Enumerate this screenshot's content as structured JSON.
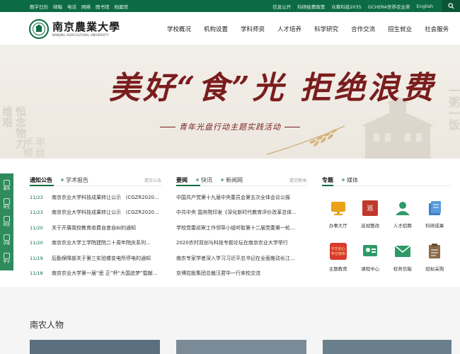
{
  "topbar": {
    "left_links": [
      "教学日历",
      "邮箱",
      "电话",
      "网络",
      "图书馆",
      "档案馆"
    ],
    "right_links": [
      "信息公开",
      "科研经费政策",
      "众筹科技2035",
      "GCHERA世界农业奖",
      "English"
    ],
    "search_icon": "search-icon"
  },
  "header": {
    "logo_cn": "南京農業大學",
    "logo_en": "NANJING AGRICULTURAL UNIVERSITY",
    "nav": [
      "学校概况",
      "机构设置",
      "学科师资",
      "人才培养",
      "科学研究",
      "合作交流",
      "招生就业",
      "社会服务"
    ]
  },
  "banner": {
    "headline": "美好“食”光 拒绝浪费",
    "subtitle": "青年光盘行动主题实践活动",
    "left_bg_chars": "恒念物力维艰",
    "left_bg_chars2": "半丝半缕",
    "right_bg_chars": "一粥一饭"
  },
  "sidefloat": [
    "服务",
    "师生",
    "校友",
    "访客",
    "学子"
  ],
  "news_a": {
    "tabs": [
      "通知公告",
      "学术报告"
    ],
    "more": "提交公告",
    "items": [
      {
        "date": "11/23",
        "title": "南京农业大学科技成果转让公示 （CGZR2020..."
      },
      {
        "date": "11/23",
        "title": "南京农业大学科技成果转让公示 （CGZR2020..."
      },
      {
        "date": "11/20",
        "title": "关于开展我校教育收费自查自纠的通知"
      },
      {
        "date": "11/20",
        "title": "南京农业大学工学院建院二十周年院庆系列..."
      },
      {
        "date": "11/19",
        "title": "后勤保障部关于第三实验楼变电所停电的通知"
      },
      {
        "date": "11/18",
        "title": "南京农业大学第一届“思 正”杯“大国追梦”暨献..."
      }
    ]
  },
  "news_b": {
    "tabs": [
      "要闻",
      "快讯",
      "新闻网"
    ],
    "more": "提交新闻",
    "items": [
      "中国共产党第十九届中央委员会第五次全体会议公报",
      "中共中央 国务院印发《深化新时代教育评价改革总体...",
      "学校党委巡察工作领导小组听取第十二届党委第一轮...",
      "2020农村双创与科技专题论坛在南京农业大学举行",
      "南农专家学者深入学习习近平总书记在全面推动长江...",
      "京博控股集团总裁汪君华一行来校交流"
    ]
  },
  "special": {
    "tabs": [
      "专题",
      "媒体"
    ],
    "items": [
      {
        "label": "办事大厅",
        "icon": "office-hall-icon",
        "color": "#e8a317"
      },
      {
        "label": "巡视整改",
        "icon": "inspection-icon",
        "color": "#c0392b"
      },
      {
        "label": "人才招聘",
        "icon": "recruit-icon",
        "color": "#2e9a68"
      },
      {
        "label": "科研成果",
        "icon": "research-icon",
        "color": "#3d7fc4"
      },
      {
        "label": "主题教育",
        "icon": "theme-education-icon",
        "color": "#d83a2e"
      },
      {
        "label": "课程中心",
        "icon": "course-icon",
        "color": "#2e9a68"
      },
      {
        "label": "校务信箱",
        "icon": "mail-icon",
        "color": "#2e9a68"
      },
      {
        "label": "招标采购",
        "icon": "procurement-icon",
        "color": "#8a6a4a"
      }
    ],
    "badge_text": "不忘初心牢记使命"
  },
  "people": {
    "title": "南农人物"
  },
  "colors": {
    "brand": "#0d6b43",
    "banner_red": "#7a1d1d"
  }
}
